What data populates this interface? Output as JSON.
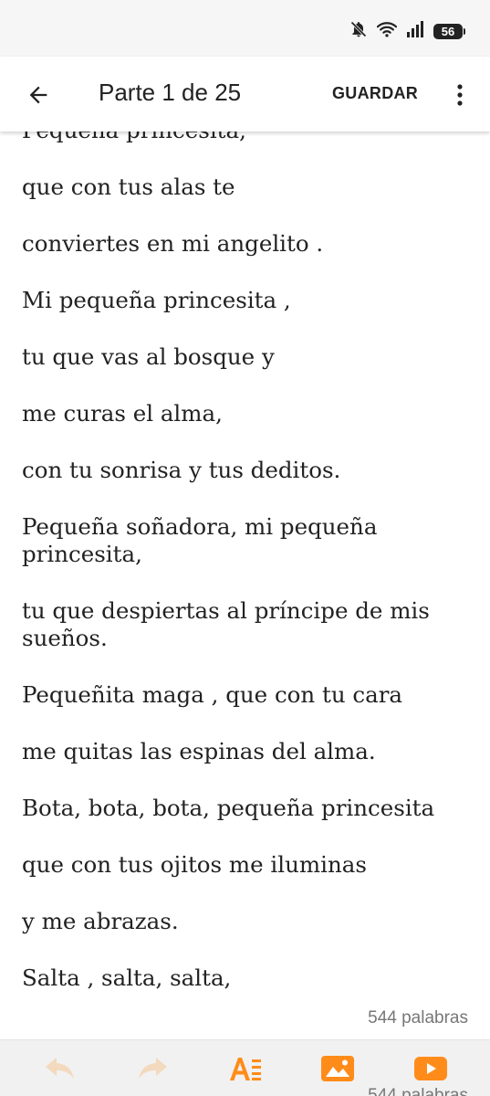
{
  "status_bar": {
    "battery_level": "56",
    "icons": [
      "bell-off-icon",
      "wifi-icon",
      "signal-icon",
      "battery-icon"
    ]
  },
  "app_bar": {
    "title": "Parte 1 de 25",
    "save_label": "GUARDAR",
    "icons": [
      "back-arrow-icon",
      "more-vert-icon"
    ]
  },
  "editor": {
    "lines": [
      "Pequeña princesita,",
      "que con tus alas te",
      "conviertes en mi angelito .",
      "Mi pequeña princesita ,",
      "tu que vas al bosque y",
      "me curas el alma,",
      "con tu sonrisa y tus deditos.",
      "Pequeña soñadora, mi pequeña princesita,",
      "tu que despiertas al príncipe de mis sueños.",
      "Pequeñita maga , que con tu cara",
      "me quitas las espinas del alma.",
      "Bota, bota, bota, pequeña princesita",
      "que con tus ojitos me iluminas",
      "y me abrazas.",
      "Salta , salta, salta,"
    ],
    "word_count": "544 palabras"
  },
  "toolbar": {
    "icons": [
      "undo-icon",
      "redo-icon",
      "text-format-icon",
      "insert-image-icon",
      "insert-video-icon"
    ],
    "accent_color": "#ff8c1a",
    "disabled_color": "#f3d9bd"
  }
}
